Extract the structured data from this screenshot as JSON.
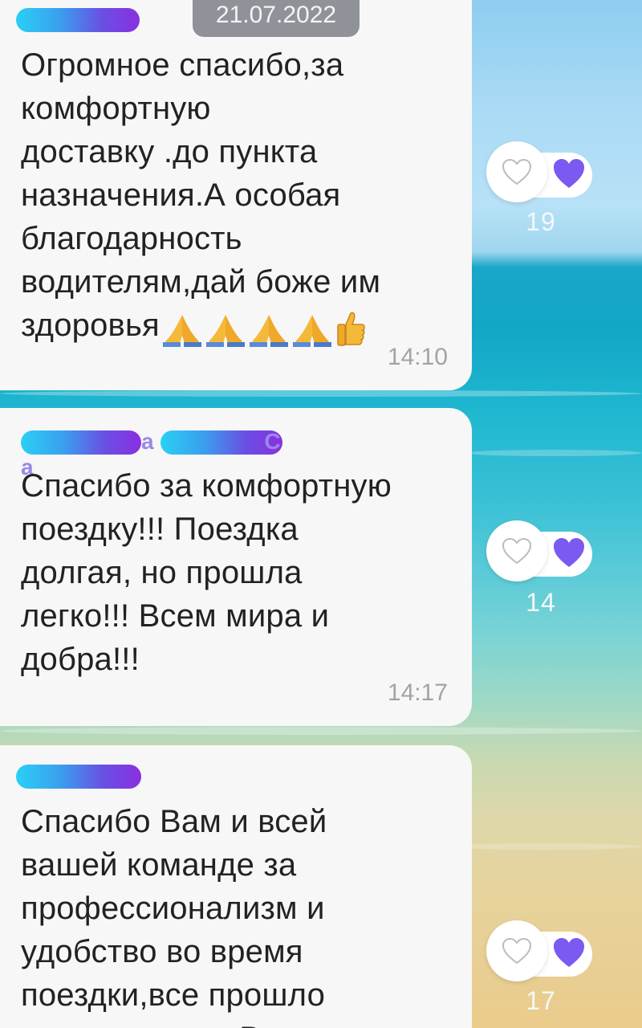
{
  "date_label": "21.07.2022",
  "messages": [
    {
      "sender": "",
      "text": "Огромное спасибо,за\nкомфортную\nдоставку .до пункта\nназначения.А особая\nблагодарность\nводителям,дай боже им\nздоровья",
      "emojis": [
        "folded-hands",
        "folded-hands",
        "folded-hands",
        "folded-hands",
        "thumbs-up"
      ],
      "time": "14:10",
      "reactions": {
        "count": "19",
        "icons": [
          "heart-outline-icon",
          "heart-filled-icon"
        ]
      }
    },
    {
      "sender": "а С а",
      "text": "Спасибо за комфортную\nпоездку!!! Поездка\nдолгая, но прошла\nлегко!!! Всем мира и\nдобра!!!",
      "time": "14:17",
      "reactions": {
        "count": "14",
        "icons": [
          "heart-outline-icon",
          "heart-filled-icon"
        ]
      }
    },
    {
      "sender": "",
      "text": "Спасибо Вам и всей\nвашей команде за\nпрофессионализм и\nудобство во время\nпоездки,все прошло\nзамечательно.Водители",
      "reactions": {
        "count": "17",
        "icons": [
          "heart-outline-icon",
          "heart-filled-icon"
        ]
      }
    }
  ],
  "colors": {
    "bubble": "#f7f7f7",
    "accent_heart": "#7a5af0",
    "date_pill": "#8f9399",
    "time_text": "#a3a3a3"
  }
}
